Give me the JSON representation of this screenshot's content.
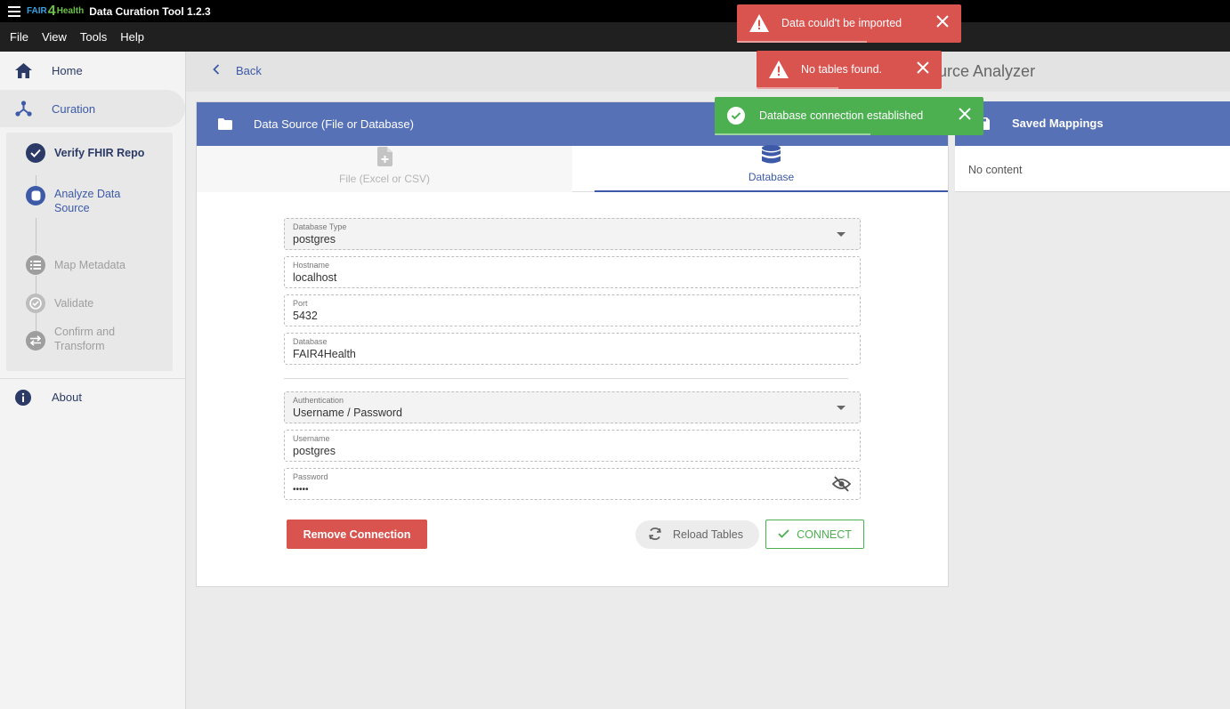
{
  "app": {
    "logo_fair": "FAIR",
    "logo_mark": "4",
    "logo_health": "Health",
    "title": "Data Curation Tool 1.2.3"
  },
  "menu": [
    "File",
    "View",
    "Tools",
    "Help"
  ],
  "sidebar": {
    "home": "Home",
    "curation": "Curation",
    "steps": [
      {
        "label": "Verify FHIR Repo",
        "state": "done"
      },
      {
        "label": "Analyze Data Source",
        "state": "active"
      },
      {
        "label": "Map Metadata",
        "state": "pending"
      },
      {
        "label": "Validate",
        "state": "pending"
      },
      {
        "label": "Confirm and Transform",
        "state": "pending"
      }
    ],
    "about": "About"
  },
  "header": {
    "back_label": "Back",
    "title": "ource Analyzer"
  },
  "datasource": {
    "title": "Data Source (File or Database)",
    "tabs": [
      {
        "label": "File (Excel or CSV)",
        "active": false
      },
      {
        "label": "Database",
        "active": true
      }
    ],
    "fields": {
      "db_type": {
        "label": "Database Type",
        "value": "postgres"
      },
      "hostname": {
        "label": "Hostname",
        "value": "localhost"
      },
      "port": {
        "label": "Port",
        "value": "5432"
      },
      "database": {
        "label": "Database",
        "value": "FAIR4Health"
      },
      "auth": {
        "label": "Authentication",
        "value": "Username / Password"
      },
      "username": {
        "label": "Username",
        "value": "postgres"
      },
      "password": {
        "label": "Password",
        "value": "•••••"
      }
    },
    "buttons": {
      "remove": "Remove Connection",
      "reload": "Reload Tables",
      "connect": "CONNECT"
    }
  },
  "saved_mappings": {
    "title": "Saved Mappings",
    "empty": "No content"
  },
  "toasts": [
    {
      "message": "Data could't be imported",
      "type": "error"
    },
    {
      "message": "No tables found.",
      "type": "error"
    },
    {
      "message": "Database connection established",
      "type": "success"
    }
  ],
  "colors": {
    "primary": "#5671b5",
    "danger": "#d9534f",
    "success": "#4caf50"
  }
}
